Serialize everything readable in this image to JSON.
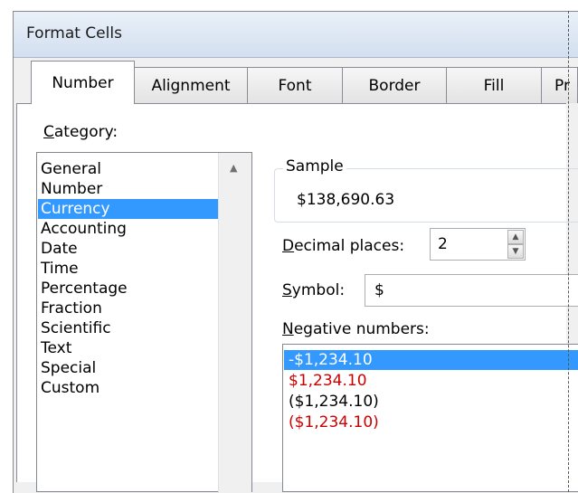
{
  "window": {
    "title": "Format Cells"
  },
  "tabs": [
    {
      "label": "Number",
      "active": true
    },
    {
      "label": "Alignment",
      "active": false
    },
    {
      "label": "Font",
      "active": false
    },
    {
      "label": "Border",
      "active": false
    },
    {
      "label": "Fill",
      "active": false
    },
    {
      "label": "Pr",
      "active": false
    }
  ],
  "category": {
    "label_u": "C",
    "label_rest": "ategory:",
    "items": [
      "General",
      "Number",
      "Currency",
      "Accounting",
      "Date",
      "Time",
      "Percentage",
      "Fraction",
      "Scientific",
      "Text",
      "Special",
      "Custom"
    ],
    "selected": "Currency"
  },
  "sample": {
    "title": "Sample",
    "value": "$138,690.63"
  },
  "decimal_places": {
    "label_u": "D",
    "label_rest": "ecimal places:",
    "value": "2"
  },
  "symbol": {
    "label_u": "S",
    "label_rest": "ymbol:",
    "value": "$"
  },
  "negative_numbers": {
    "label_u": "N",
    "label_rest": "egative numbers:",
    "items": [
      {
        "text": "-$1,234.10",
        "color": "#000000",
        "selected": true
      },
      {
        "text": "$1,234.10",
        "color": "#cc0000",
        "selected": false
      },
      {
        "text": "($1,234.10)",
        "color": "#000000",
        "selected": false
      },
      {
        "text": "($1,234.10)",
        "color": "#cc0000",
        "selected": false
      }
    ]
  },
  "colors": {
    "selection": "#3399ff",
    "negative_red": "#cc0000",
    "titlebar": "#dce6f4"
  }
}
